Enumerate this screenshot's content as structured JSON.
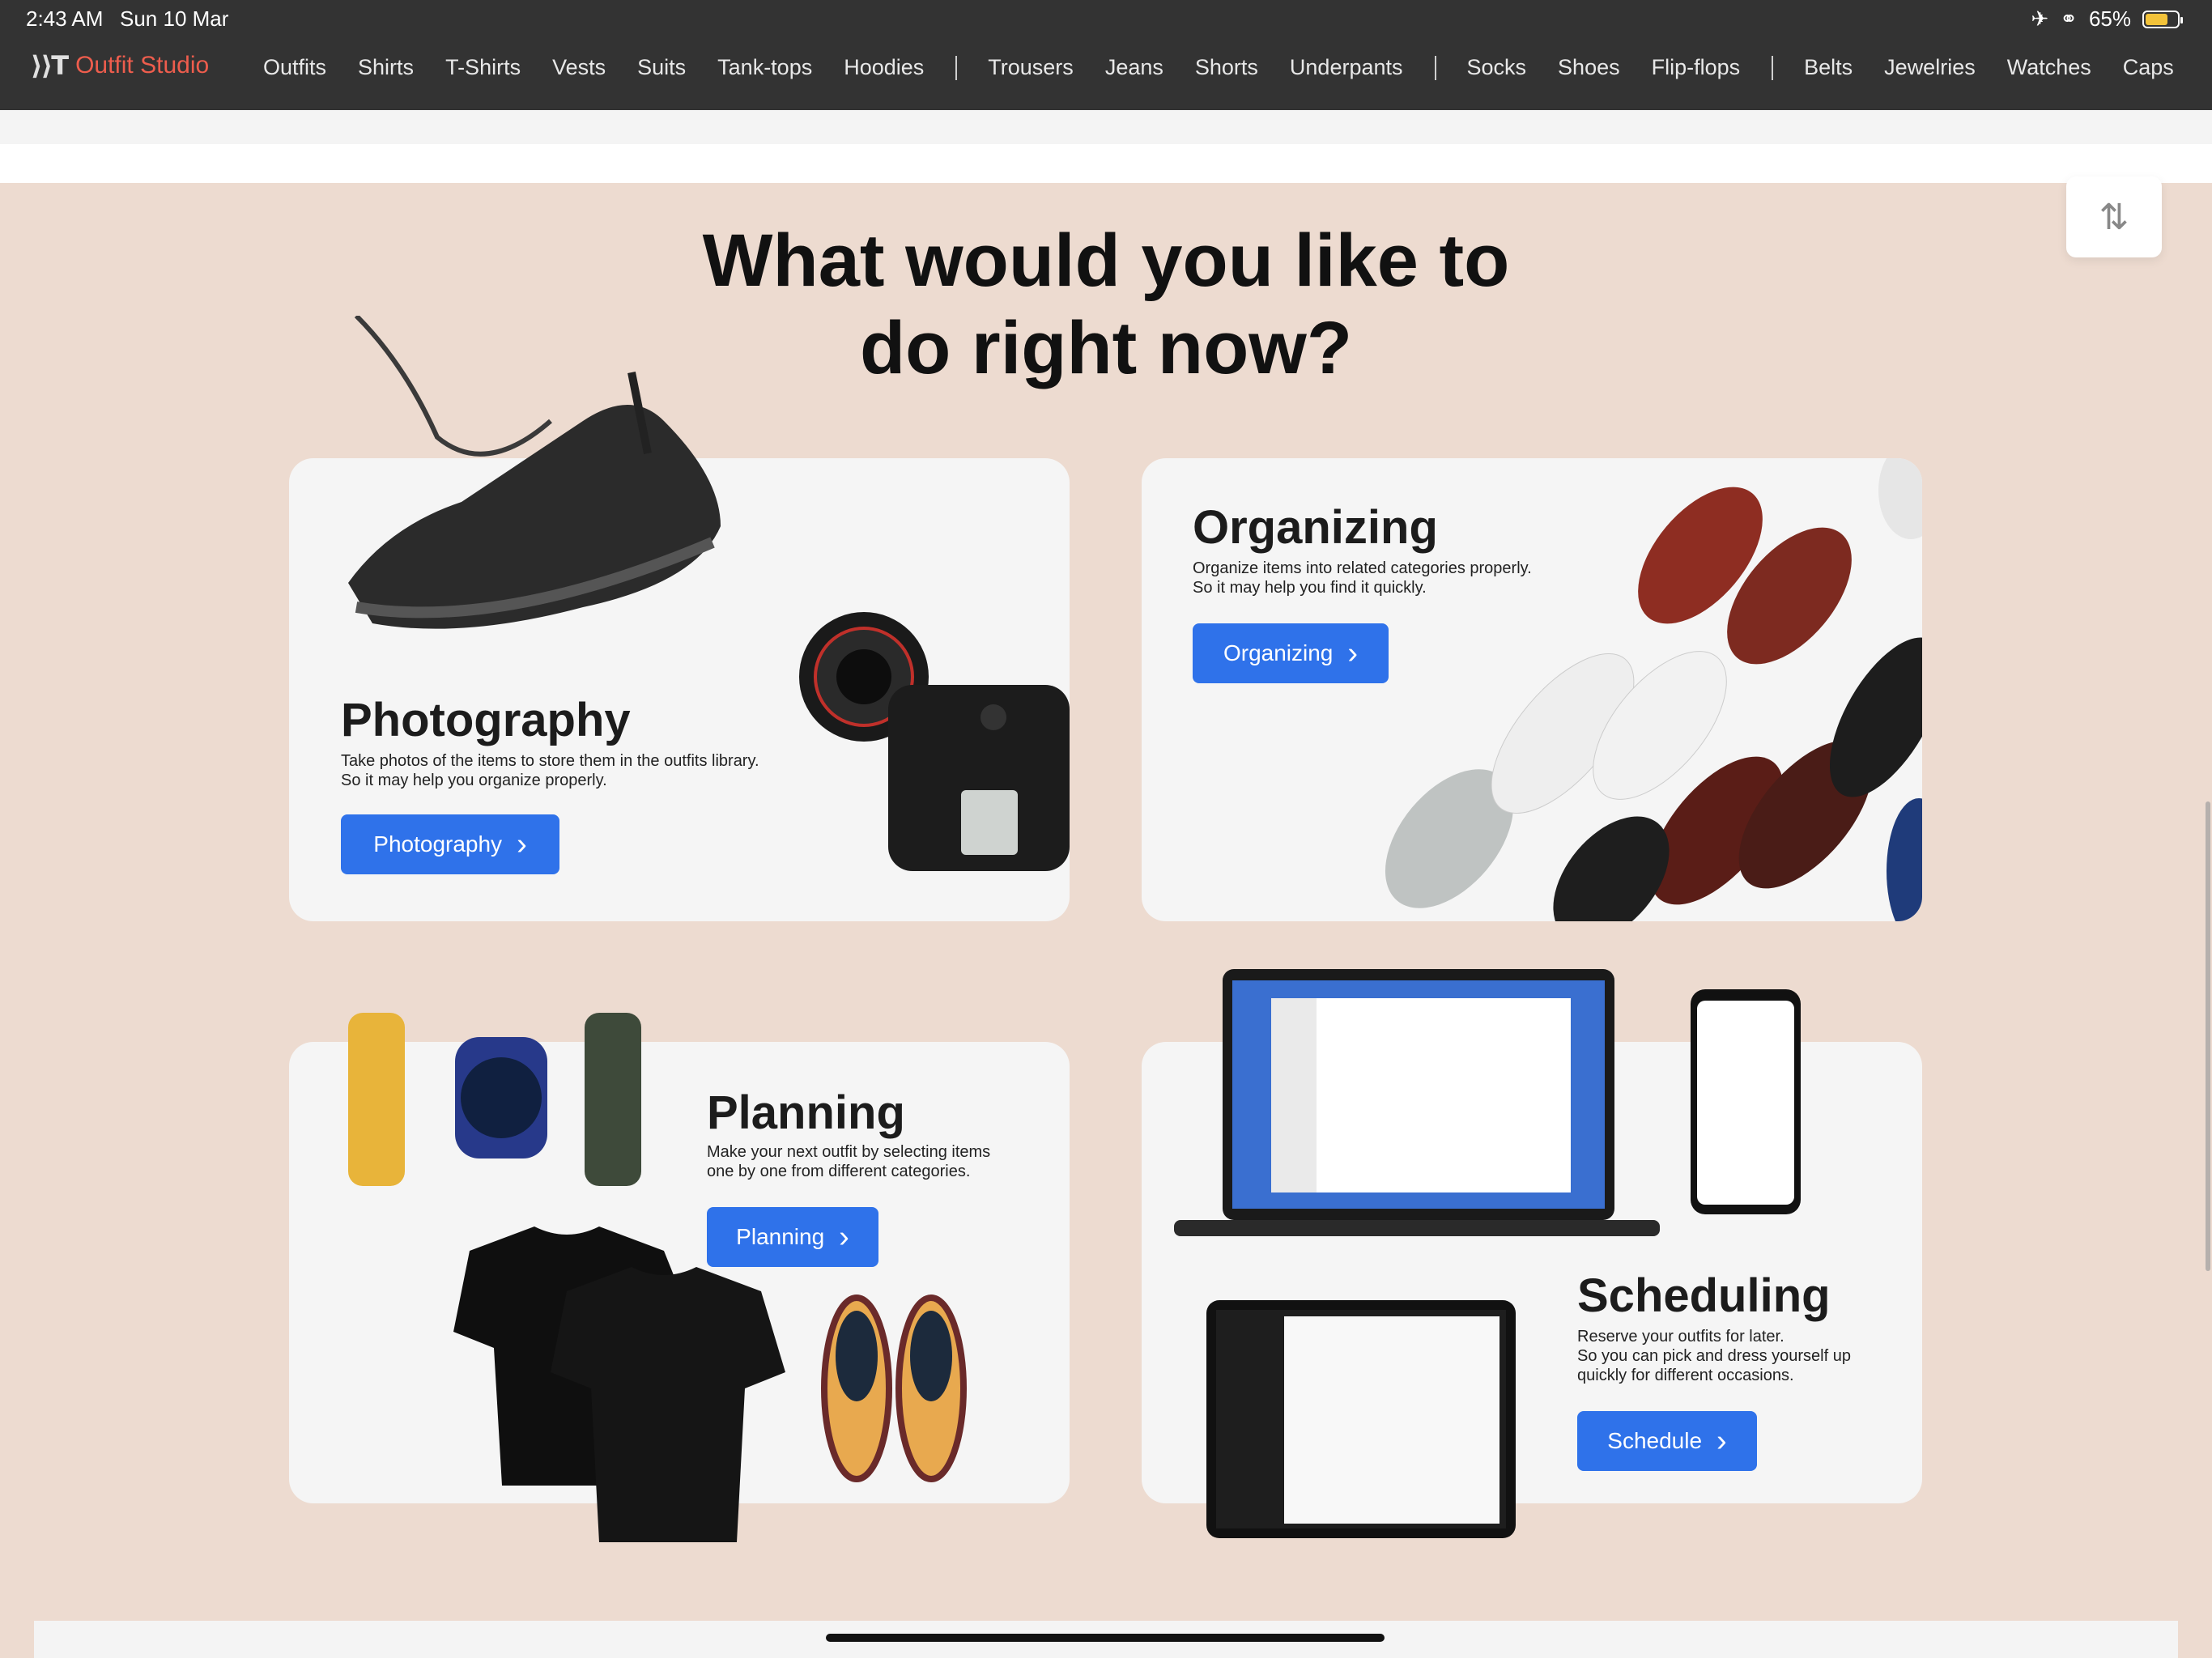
{
  "status_bar": {
    "time": "2:43 AM",
    "date": "Sun 10 Mar",
    "battery": "65%",
    "battery_level": 0.65,
    "icons": [
      "airplane-mode-icon",
      "link-icon",
      "battery-icon"
    ]
  },
  "nav": {
    "brand": "Outfit Studio",
    "logo_mark": "⟩⟩T",
    "group1": [
      "Outfits",
      "Shirts",
      "T-Shirts",
      "Vests",
      "Suits",
      "Tank-tops",
      "Hoodies"
    ],
    "group2": [
      "Trousers",
      "Jeans",
      "Shorts",
      "Underpants"
    ],
    "group3": [
      "Socks",
      "Shoes",
      "Flip-flops"
    ],
    "group4": [
      "Belts",
      "Jewelries",
      "Watches",
      "Caps"
    ]
  },
  "sort_icon": "⇅",
  "heading": {
    "line1": "What would you like to",
    "line2": "do right now?"
  },
  "cards": {
    "photography": {
      "title": "Photography",
      "desc1": "Take photos of the items to store them in the outfits library.",
      "desc2": "So it may help you organize properly.",
      "button": "Photography",
      "chevron": "›"
    },
    "organizing": {
      "title": "Organizing",
      "desc1": "Organize items into related categories properly.",
      "desc2": "So it may help you find it quickly.",
      "button": "Organizing",
      "chevron": "›"
    },
    "planning": {
      "title": "Planning",
      "desc1": "Make your next outfit by selecting items",
      "desc2": "one by one from different categories.",
      "button": "Planning",
      "chevron": "›"
    },
    "scheduling": {
      "title": "Scheduling",
      "desc1": "Reserve your outfits for later.",
      "desc2": "So you can pick and dress yourself up",
      "desc3": "quickly for different occasions.",
      "button": "Schedule",
      "chevron": "›"
    }
  },
  "colors": {
    "bar_bg": "#333333",
    "brand": "#ee5d4d",
    "page_bg": "#eddbd0",
    "card_bg": "#f5f5f5",
    "button_bg": "#2f72ea"
  }
}
